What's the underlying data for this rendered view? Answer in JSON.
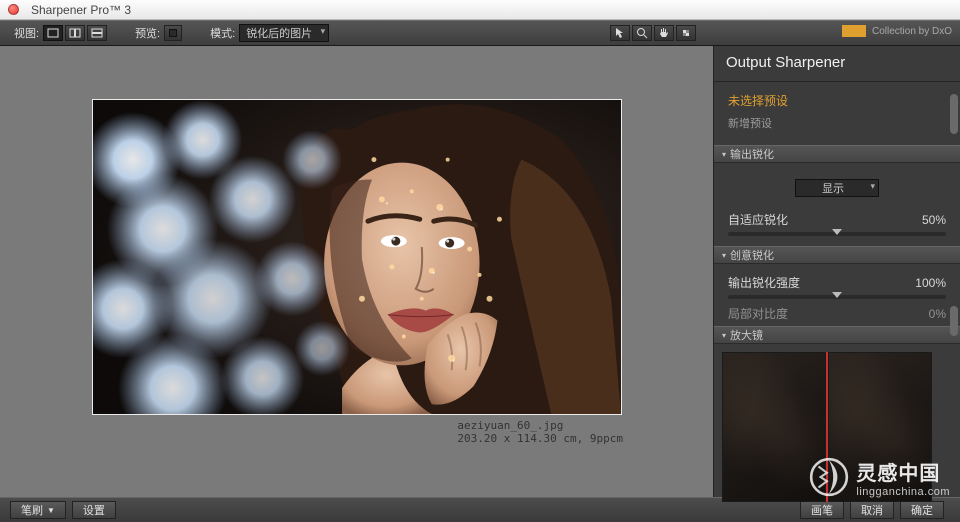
{
  "title": "Sharpener Pro™ 3",
  "toolbar": {
    "view_label": "视图:",
    "preview_label": "预览:",
    "mode_label": "模式:",
    "mode_value": "锐化后的图片"
  },
  "brand": {
    "text": "Collection by DxO"
  },
  "canvas": {
    "filename": "aeziyuan_60_.jpg",
    "dimensions": "203.20 x 114.30 cm, 9ppcm"
  },
  "side": {
    "panel_title": "Output Sharpener",
    "presets": {
      "selected": "未选择预设",
      "add": "新增预设"
    },
    "sections": {
      "output": "输出锐化",
      "creative": "创意锐化",
      "magnifier": "放大镜"
    },
    "controls": {
      "display_label": "显示",
      "adaptive_label": "自适应锐化",
      "adaptive_value": "50%",
      "strength_label": "输出锐化强度",
      "strength_value": "100%",
      "local_label": "局部对比度",
      "local_value": "0%"
    }
  },
  "footer": {
    "brush": "笔刷",
    "settings": "设置",
    "brush2": "画笔",
    "cancel": "取消",
    "ok": "确定"
  },
  "watermark": {
    "cn": "灵感中国",
    "en": "lingganchina.com"
  }
}
